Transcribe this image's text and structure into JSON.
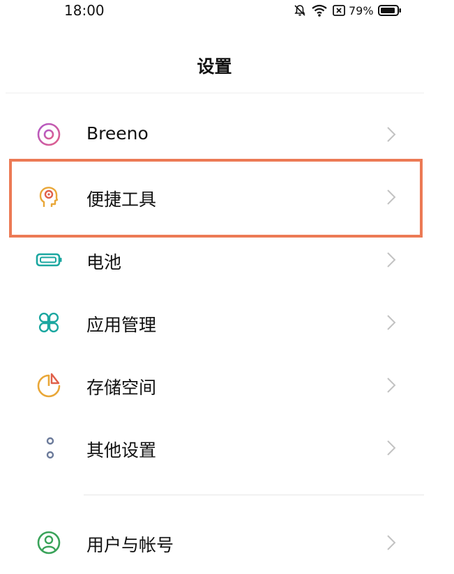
{
  "status_bar": {
    "time": "18:00",
    "battery_percent": "79%",
    "icons": [
      "bell-off-icon",
      "wifi-icon",
      "sim-no-signal-icon",
      "battery-icon"
    ]
  },
  "header": {
    "title": "设置"
  },
  "items": [
    {
      "label": "Breeno",
      "icon": "breeno-icon",
      "color": "#b158c8"
    },
    {
      "label": "便捷工具",
      "icon": "convenience-tools-icon",
      "color": "#e9a738"
    },
    {
      "label": "电池",
      "icon": "battery-setting-icon",
      "color": "#1ba7a0"
    },
    {
      "label": "应用管理",
      "icon": "app-management-icon",
      "color": "#1ba7a0"
    },
    {
      "label": "存储空间",
      "icon": "storage-icon",
      "color": "#e9a738"
    },
    {
      "label": "其他设置",
      "icon": "other-settings-icon",
      "color": "#6b7a9a"
    },
    {
      "label": "用户与帐号",
      "icon": "user-account-icon",
      "color": "#3aa35a"
    }
  ],
  "highlight": {
    "color": "#ec7a55",
    "item": "便捷工具"
  }
}
